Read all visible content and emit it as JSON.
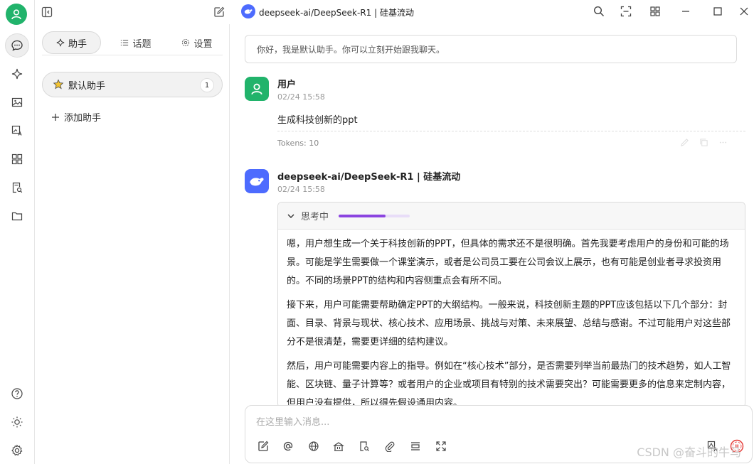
{
  "window": {
    "title": "deepseek-ai/DeepSeek-R1 | 硅基流动"
  },
  "sidebar": {
    "tabs": [
      {
        "label": "助手",
        "icon": "sparkle-icon",
        "active": true
      },
      {
        "label": "话题",
        "icon": "list-icon",
        "active": false
      },
      {
        "label": "设置",
        "icon": "gear-icon",
        "active": false
      }
    ],
    "assistants": [
      {
        "label": "默认助手",
        "icon": "star-icon",
        "count": "1"
      }
    ],
    "add_label": "添加助手"
  },
  "chat": {
    "welcome": "你好，我是默认助手。你可以立刻开始跟我聊天。",
    "user_message": {
      "name": "用户",
      "time": "02/24 15:58",
      "text": "生成科技创新的ppt",
      "tokens": "Tokens: 10"
    },
    "bot_message": {
      "name": "deepseek-ai/DeepSeek-R1 | 硅基流动",
      "time": "02/24 15:58",
      "thinking_label": "思考中",
      "thinking_progress": 0.66,
      "paragraphs": [
        "嗯，用户想生成一个关于科技创新的PPT，但具体的需求还不是很明确。首先我要考虑用户的身份和可能的场景。可能是学生需要做一个课堂演示，或者是公司员工要在公司会议上展示，也有可能是创业者寻求投资用的。不同的场景PPT的结构和内容侧重点会有所不同。",
        "接下来，用户可能需要帮助确定PPT的大纲结构。一般来说，科技创新主题的PPT应该包括以下几个部分：封面、目录、背景与现状、核心技术、应用场景、挑战与对策、未来展望、总结与感谢。不过可能用户对这些部分不是很清楚，需要更详细的结构建议。",
        "然后，用户可能需要内容上的指导。例如在“核心技术”部分，是否需要列举当前最热门的技术趋势，如人工智能、区块链、量子计算等？或者用户的企业或项目有特别的技术需要突出？可能需要更多的信息来定制内容，但用户没有提供，所以得先假设通用内容。"
      ]
    }
  },
  "composer": {
    "placeholder": "在这里输入消息..."
  },
  "watermark": "CSDN @奋斗的牛马",
  "colors": {
    "user_avatar": "#21b36b",
    "bot_avatar": "#4d6bfe",
    "progress": "#8b44e0",
    "stop_button": "#e53935"
  }
}
